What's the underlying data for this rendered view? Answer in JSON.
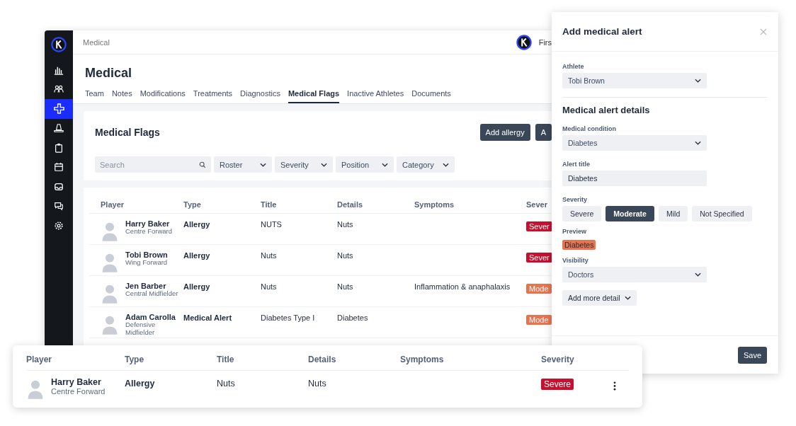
{
  "app": {
    "breadcrumb": "Medical",
    "user_name": "Firs",
    "title": "Medical",
    "sidebar": {
      "items": [
        {
          "kind": "chart",
          "selected": false
        },
        {
          "kind": "people",
          "selected": false
        },
        {
          "kind": "plus",
          "selected": true
        },
        {
          "kind": "cone",
          "selected": false
        },
        {
          "kind": "clipboard",
          "selected": false
        },
        {
          "kind": "calendar",
          "selected": false
        },
        {
          "kind": "inbox",
          "selected": false
        },
        {
          "kind": "chat",
          "selected": false
        },
        {
          "kind": "gear",
          "selected": false
        }
      ]
    },
    "tabs": [
      {
        "label": "Team",
        "selected": false
      },
      {
        "label": "Notes",
        "selected": false
      },
      {
        "label": "Modifications",
        "selected": false
      },
      {
        "label": "Treatments",
        "selected": false
      },
      {
        "label": "Diagnostics",
        "selected": false
      },
      {
        "label": "Medical Flags",
        "selected": true
      },
      {
        "label": "Inactive Athletes",
        "selected": false
      },
      {
        "label": "Documents",
        "selected": false
      }
    ]
  },
  "flags": {
    "title": "Medical Flags",
    "buttons": [
      "Add allergy",
      "A"
    ],
    "search": {
      "placeholder": "Search"
    },
    "filters": [
      "Roster",
      "Severity",
      "Position",
      "Category"
    ]
  },
  "table": {
    "columns": [
      "Player",
      "Type",
      "Title",
      "Details",
      "Symptoms",
      "Sever"
    ],
    "rows": [
      {
        "player": "Harry Baker",
        "position": "Centre Forward",
        "type": "Allergy",
        "title": "NUTS",
        "details": "Nuts",
        "severity": {
          "text": "Sever",
          "color": "#c8102e"
        }
      },
      {
        "player": "Tobi Brown",
        "position": "Wing Forward",
        "type": "Allergy",
        "title": "Nuts",
        "details": "Nuts",
        "severity": {
          "text": "Sever",
          "color": "#c8102e"
        }
      },
      {
        "player": "Jen Barber",
        "position": "Central Midfielder",
        "type": "Allergy",
        "title": "Nuts",
        "details": "Nuts",
        "symptoms": "Inflammation & anaphalaxis",
        "severity": {
          "text": "Mode",
          "color": "#e8744f"
        }
      },
      {
        "player": "Adam Carolla",
        "position": "Defensive Midfielder",
        "type": "Medical Alert",
        "title": "Diabetes Type I",
        "details": "Diabetes",
        "severity": {
          "text": "Mode",
          "color": "#e8744f"
        }
      }
    ]
  },
  "detail_card": {
    "columns": [
      "Player",
      "Type",
      "Title",
      "Details",
      "Symptoms",
      "Severity"
    ],
    "row": {
      "player": "Harry Baker",
      "position": "Centre Forward",
      "type": "Allergy",
      "title": "Nuts",
      "details": "Nuts",
      "severity": {
        "text": "Severe",
        "color": "#c8102e"
      }
    }
  },
  "drawer": {
    "title": "Add medical alert",
    "athlete": {
      "label": "Athlete",
      "value": "Tobi Brown"
    },
    "section_title": "Medical alert details",
    "condition": {
      "label": "Medical condition",
      "value": "Diabetes"
    },
    "alert_title": {
      "label": "Alert title",
      "value": "Diabetes"
    },
    "severity": {
      "label": "Severity",
      "options": [
        {
          "label": "Severe",
          "selected": false
        },
        {
          "label": "Moderate",
          "selected": true
        },
        {
          "label": "Mild",
          "selected": false
        },
        {
          "label": "Not Specified",
          "selected": false
        }
      ]
    },
    "preview": {
      "label": "Preview",
      "text": "Diabetes",
      "color": "#e8744f"
    },
    "visibility": {
      "label": "Visibility",
      "value": "Doctors"
    },
    "more_button": "Add more detail",
    "save_button": "Save"
  }
}
